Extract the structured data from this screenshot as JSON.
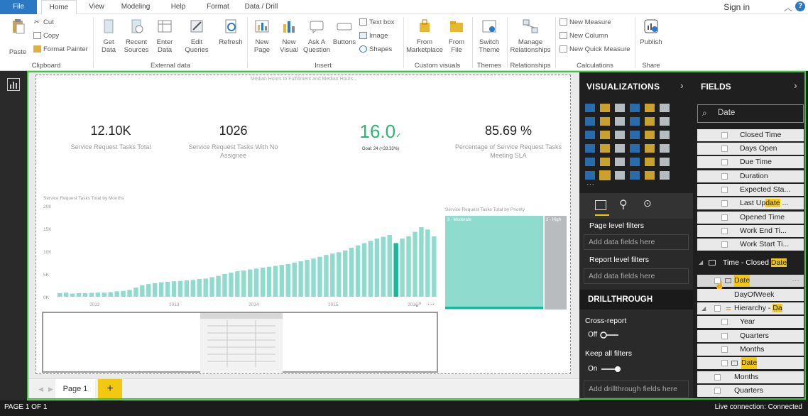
{
  "tabs": {
    "file": "File",
    "home": "Home",
    "view": "View",
    "modeling": "Modeling",
    "help": "Help",
    "format": "Format",
    "data_drill": "Data / Drill"
  },
  "account": {
    "signin": "Sign in",
    "help": "?"
  },
  "ribbon": {
    "paste": "Paste",
    "cut": "Cut",
    "copy": "Copy",
    "format_painter": "Format Painter",
    "get_data": "Get Data",
    "recent_sources": "Recent Sources",
    "enter_data": "Enter Data",
    "edit_queries": "Edit Queries",
    "refresh": "Refresh",
    "new_page": "New Page",
    "new_visual": "New Visual",
    "ask_a_question": "Ask A Question",
    "buttons": "Buttons",
    "text_box": "Text box",
    "image": "Image",
    "shapes": "Shapes",
    "from_marketplace": "From Marketplace",
    "from_file": "From File",
    "switch_theme": "Switch Theme",
    "manage_relationships": "Manage Relationships",
    "new_measure": "New Measure",
    "new_column": "New Column",
    "new_quick_measure": "New Quick Measure",
    "publish": "Publish",
    "groups": {
      "clipboard": "Clipboard",
      "external_data": "External data",
      "insert": "Insert",
      "custom_visuals": "Custom visuals",
      "themes": "Themes",
      "relationships": "Relationships",
      "calculations": "Calculations",
      "share": "Share"
    }
  },
  "report": {
    "top_title": "Median Hours to Fulfillment and Median Hours...",
    "kpis": [
      {
        "value": "12.10K",
        "label": "Service Request Tasks Total"
      },
      {
        "value": "1026",
        "label": "Service Request Tasks With No Assignee"
      },
      {
        "value": "16.0",
        "goal": "Goal: 24 (+33.33%)"
      },
      {
        "value": "85.69 %",
        "label": "Percentage of Service Request Tasks Meeting SLA"
      }
    ],
    "treemap_title": "Service Request Tasks Total by Priority",
    "treemap_labels": [
      "3 - Moderate",
      "2 - High"
    ]
  },
  "chart_data": {
    "type": "bar",
    "title": "Service Request Tasks Total by Months",
    "yticks": [
      "20K",
      "15K",
      "10K",
      "5K",
      "0K"
    ],
    "xticks": [
      "2012",
      "2013",
      "2014",
      "2015",
      "2016"
    ],
    "ylim": [
      0,
      20000
    ],
    "values": [
      800,
      900,
      700,
      800,
      800,
      850,
      900,
      900,
      1000,
      1200,
      1300,
      1500,
      2000,
      2500,
      2800,
      3000,
      3200,
      3300,
      3400,
      3500,
      3600,
      3700,
      3900,
      4000,
      4300,
      4600,
      5000,
      5300,
      5600,
      5800,
      6000,
      6200,
      6400,
      6600,
      6800,
      7000,
      7200,
      7500,
      7800,
      8100,
      8400,
      8800,
      9200,
      9500,
      9800,
      10200,
      10800,
      11300,
      11800,
      12300,
      12800,
      13200,
      13600,
      11800,
      12800,
      13300,
      14300,
      15300,
      14800,
      13300
    ],
    "highlight_index": 53,
    "colors": {
      "bar": "#8fdccf",
      "highlight": "#18b79c"
    }
  },
  "page_tabs": {
    "page1": "Page 1",
    "add": "+"
  },
  "viz": {
    "title": "VISUALIZATIONS",
    "page_filters": "Page level filters",
    "add_fields": "Add data fields here",
    "report_filters": "Report level filters",
    "add_fields2": "Add data fields here",
    "drillthrough": "DRILLTHROUGH",
    "cross_report": "Cross-report",
    "off": "Off",
    "keep_all": "Keep all filters",
    "on": "On",
    "add_drill": "Add drillthrough fields here"
  },
  "fields": {
    "title": "FIELDS",
    "search": "Date",
    "items": [
      "Closed Time",
      "Days Open",
      "Due Time",
      "Duration",
      "Expected Sta...",
      "Last Up",
      "Opened Time",
      "Work End Ti...",
      "Work Start Ti..."
    ],
    "last_up_hl": "date",
    "last_up_suffix": " ...",
    "table": "Time - Closed ",
    "table_hl": "Date",
    "date": "Date",
    "dayofweek": "DayOfWeek",
    "hierarchy": "Hierarchy - ",
    "hierarchy_hl": "Da",
    "year": "Year",
    "quarters": "Quarters",
    "months": "Months",
    "date2": "Date",
    "months2": "Months",
    "quarters2": "Quarters"
  },
  "status": {
    "page": "PAGE 1 OF 1",
    "live": "Live connection: Connected"
  }
}
